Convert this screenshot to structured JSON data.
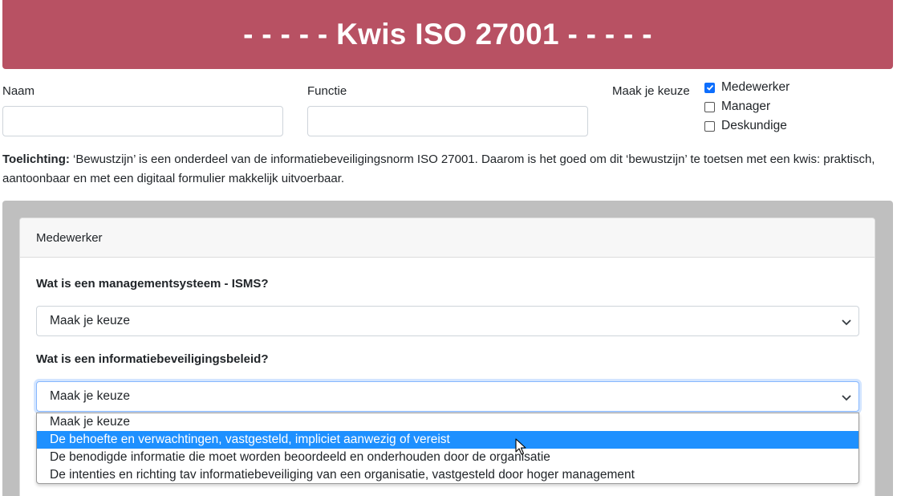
{
  "header": {
    "title": "- - - - - Kwis ISO 27001 - - - - -"
  },
  "form": {
    "name_label": "Naam",
    "name_value": "",
    "function_label": "Functie",
    "function_value": "",
    "choice_label": "Maak je keuze",
    "roles": [
      {
        "label": "Medewerker",
        "checked": true
      },
      {
        "label": "Manager",
        "checked": false
      },
      {
        "label": "Deskundige",
        "checked": false
      }
    ]
  },
  "explanation": {
    "bold": "Toelichting:",
    "text": " ‘Bewustzijn’ is een onderdeel van de informatiebeveiligingsnorm ISO 27001. Daarom is het goed om dit ‘bewustzijn’ te toetsen met een kwis: praktisch, aantoonbaar en met een digitaal formulier makkelijk uitvoerbaar."
  },
  "card": {
    "header": "Medewerker",
    "questions": [
      {
        "text": "Wat is een managementsysteem - ISMS?",
        "selected": "Maak je keuze"
      },
      {
        "text": "Wat is een informatiebeveiligingsbeleid?",
        "selected": "Maak je keuze"
      }
    ]
  },
  "dropdown": {
    "options": [
      "Maak je keuze",
      "De behoefte en verwachtingen, vastgesteld, impliciet aanwezig of vereist",
      "De benodigde informatie die moet worden beoordeeld en onderhouden door de organisatie",
      "De intenties en richting tav informatiebeveiliging van een organisatie, vastgesteld door hoger management"
    ],
    "highlighted_index": 1
  },
  "colors": {
    "header_bg": "#b85163",
    "highlight": "#1e90ff",
    "panel_bg": "#bfbfbf"
  },
  "icons": {
    "select_arrow": "chevron-down-icon",
    "checkbox": "checkmark-icon",
    "pointer": "mouse-cursor-icon"
  }
}
